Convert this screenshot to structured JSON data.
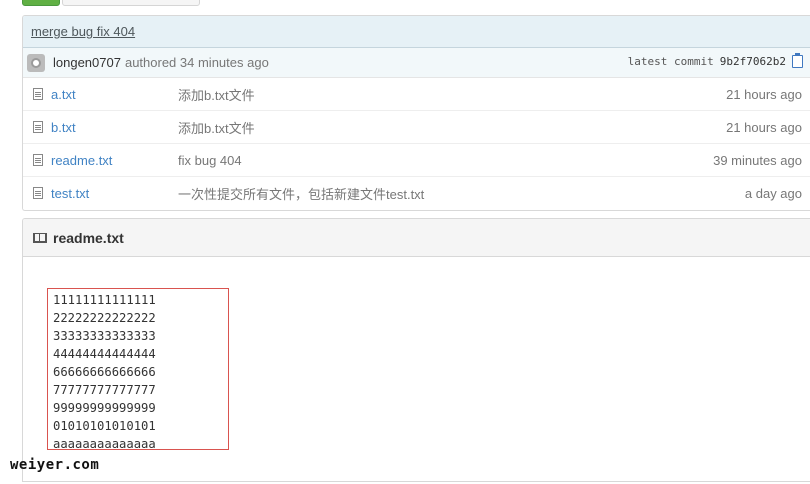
{
  "commit": {
    "title": "merge bug fix 404",
    "author": "longen0707",
    "authored_text": "authored 34 minutes ago",
    "latest_label": "latest commit",
    "sha": "9b2f7062b2"
  },
  "files": [
    {
      "name": "a.txt",
      "message": "添加b.txt文件",
      "age": "21 hours ago"
    },
    {
      "name": "b.txt",
      "message": "添加b.txt文件",
      "age": "21 hours ago"
    },
    {
      "name": "readme.txt",
      "message": "fix bug 404",
      "age": "39 minutes ago"
    },
    {
      "name": "test.txt",
      "message": "一次性提交所有文件，包括新建文件test.txt",
      "age": "a day ago"
    }
  ],
  "readme": {
    "title": "readme.txt",
    "lines": [
      "11111111111111",
      "22222222222222",
      "33333333333333",
      "44444444444444",
      "66666666666666",
      "77777777777777",
      "99999999999999",
      "01010101010101",
      "aaaaaaaaaaaaaa"
    ]
  },
  "watermark": "weiyer.com",
  "colors": {
    "link": "#4183c4",
    "commit_bg": "#e6f1f6",
    "highlight_border": "#d9534f"
  }
}
